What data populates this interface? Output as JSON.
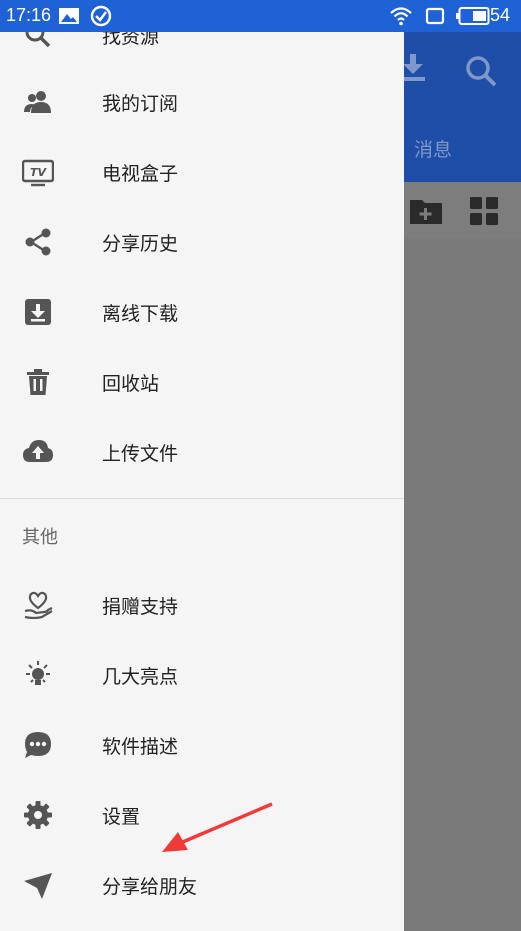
{
  "status": {
    "time": "17:16",
    "battery": "54"
  },
  "background": {
    "tab_label": "消息"
  },
  "drawer": {
    "items_top": [
      {
        "label": "找资源",
        "icon": "search-icon"
      },
      {
        "label": "我的订阅",
        "icon": "people-icon"
      },
      {
        "label": "电视盒子",
        "icon": "tv-icon"
      },
      {
        "label": "分享历史",
        "icon": "share-icon"
      },
      {
        "label": "离线下载",
        "icon": "download-box-icon"
      },
      {
        "label": "回收站",
        "icon": "trash-icon"
      },
      {
        "label": "上传文件",
        "icon": "cloud-upload-icon"
      }
    ],
    "section_title": "其他",
    "items_other": [
      {
        "label": "捐赠支持",
        "icon": "donate-heart-icon"
      },
      {
        "label": "几大亮点",
        "icon": "lightbulb-icon"
      },
      {
        "label": "软件描述",
        "icon": "chat-bubble-icon"
      },
      {
        "label": "设置",
        "icon": "gear-icon"
      },
      {
        "label": "分享给朋友",
        "icon": "send-icon"
      }
    ]
  },
  "colors": {
    "accent": "#1f62d6",
    "toolbar": "#1f4ea8",
    "arrow": "#f03a3a",
    "icon": "#555555"
  }
}
